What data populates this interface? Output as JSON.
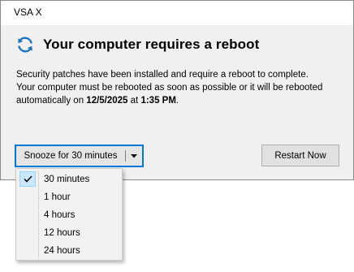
{
  "window": {
    "title": "VSA X"
  },
  "header": {
    "icon": "refresh-icon",
    "heading": "Your computer requires a reboot",
    "accent": "#1e73be"
  },
  "message": {
    "line1": "Security patches have been installed and require a reboot to complete.",
    "line2_prefix": "Your computer must be rebooted as soon as possible or it will be rebooted automatically on ",
    "date": "12/5/2025",
    "at": " at ",
    "time": "1:35 PM",
    "suffix": "."
  },
  "snooze": {
    "selected_label": "Snooze for 30 minutes"
  },
  "restart": {
    "label": "Restart Now"
  },
  "menu": {
    "items": [
      {
        "label": "30 minutes",
        "checked": true
      },
      {
        "label": "1 hour",
        "checked": false
      },
      {
        "label": "4 hours",
        "checked": false
      },
      {
        "label": "12 hours",
        "checked": false
      },
      {
        "label": "24 hours",
        "checked": false
      }
    ]
  }
}
